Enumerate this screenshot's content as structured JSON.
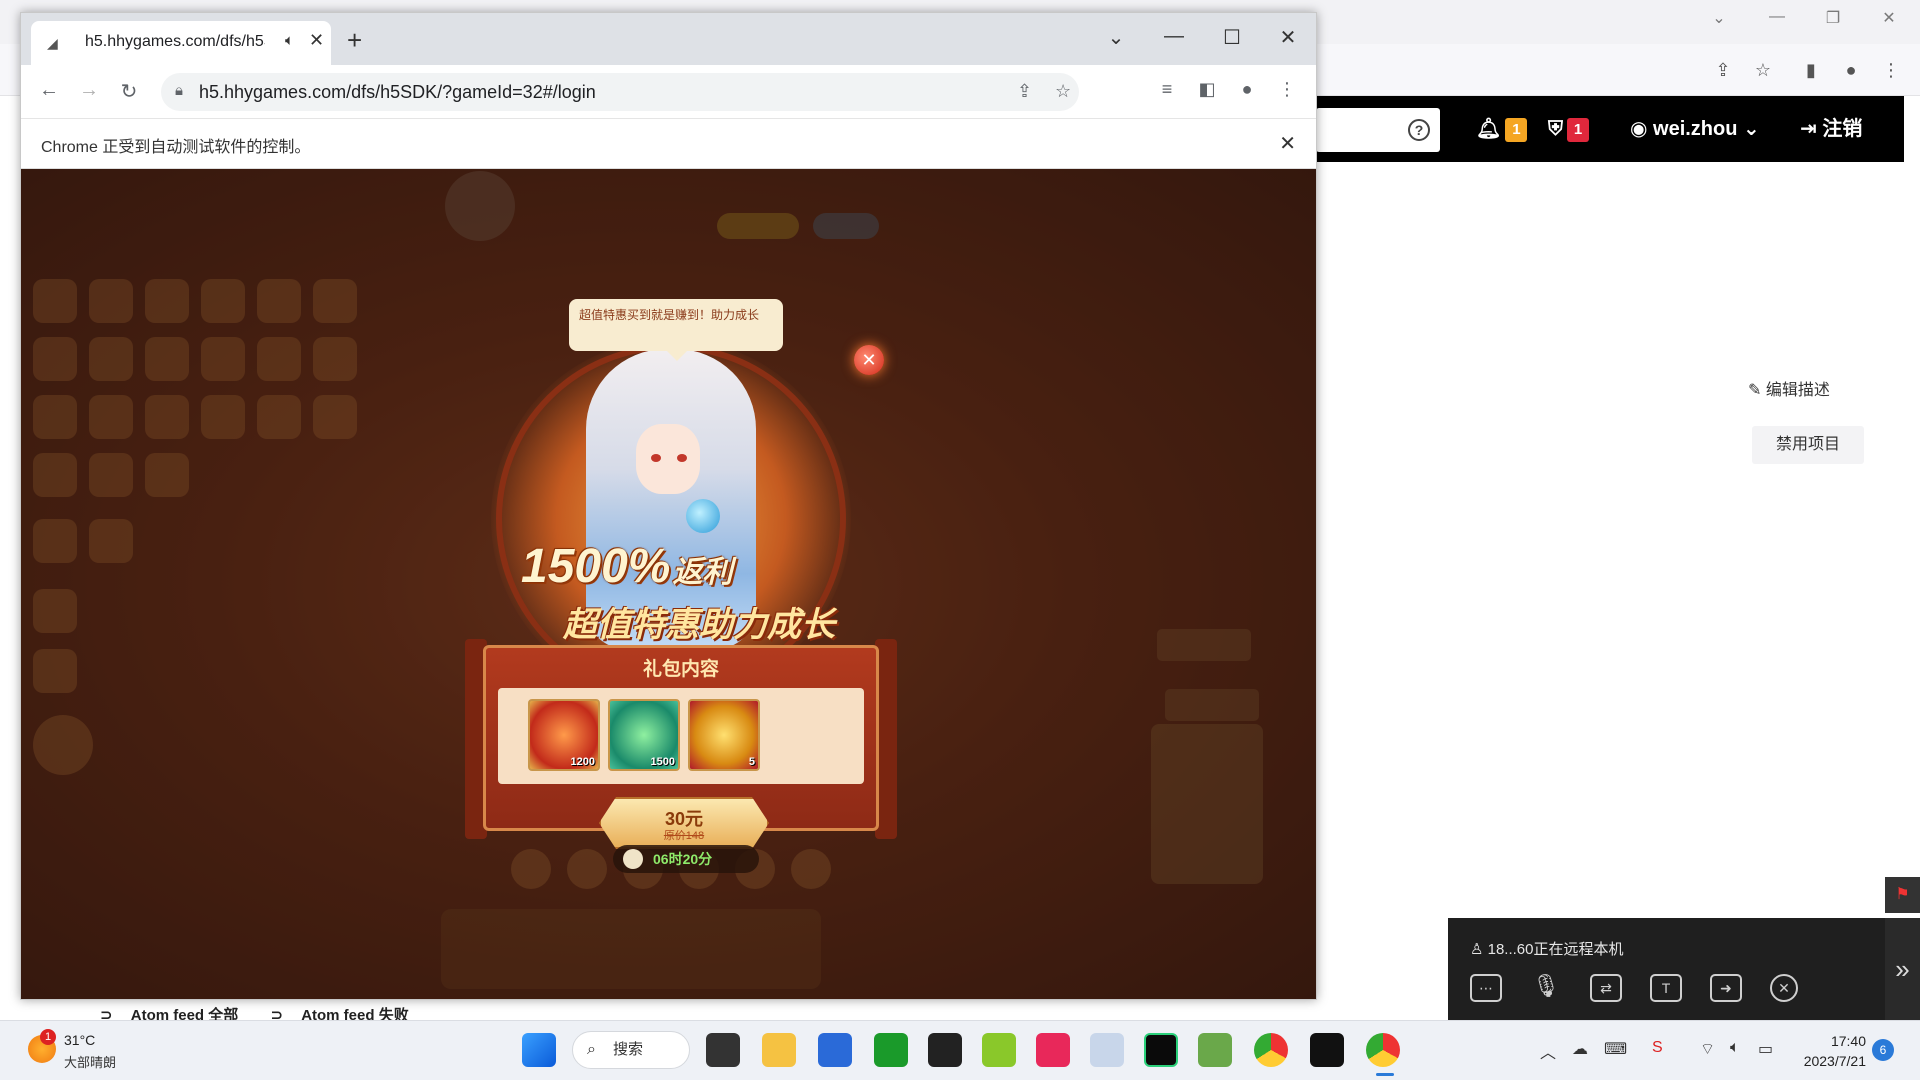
{
  "background_page": {
    "nav": {
      "notif_count": "1",
      "shield_count": "1",
      "user_name": "wei.zhou",
      "logout_label": "注销"
    },
    "edit_description_label": "编辑描述",
    "disable_project_label": "禁用项目"
  },
  "browser": {
    "tab_title": "h5.hhygames.com/dfs/h5S",
    "url": "h5.hhygames.com/dfs/h5SDK/?gameId=32#/login",
    "infobar_text": "Chrome 正受到自动测试软件的控制。"
  },
  "game": {
    "speech_text": "超值特惠买到就是赚到！助力成长",
    "promo_percent": "1500%",
    "promo_suffix": "返利",
    "promo_subtitle": "超值特惠助力成长",
    "gift_title": "礼包内容",
    "items": [
      {
        "qty": "1200"
      },
      {
        "qty": "1500"
      },
      {
        "qty": "5"
      }
    ],
    "price": "30元",
    "original_price": "原价148",
    "timer": "06时20分"
  },
  "remote": {
    "status_text": "18...60正在远程本机"
  },
  "atom_feed": {
    "item1": "Atom feed 全部",
    "item2": "Atom feed 失败"
  },
  "taskbar": {
    "temperature": "31°C",
    "weather": "大部晴朗",
    "weather_badge": "1",
    "search_label": "搜索",
    "time": "17:40",
    "date": "2023/7/21",
    "notification_count": "6"
  },
  "colors": {
    "accent_badge_orange": "#f5a623",
    "accent_badge_red": "#e0283c",
    "timer_green": "#8eea6a"
  }
}
